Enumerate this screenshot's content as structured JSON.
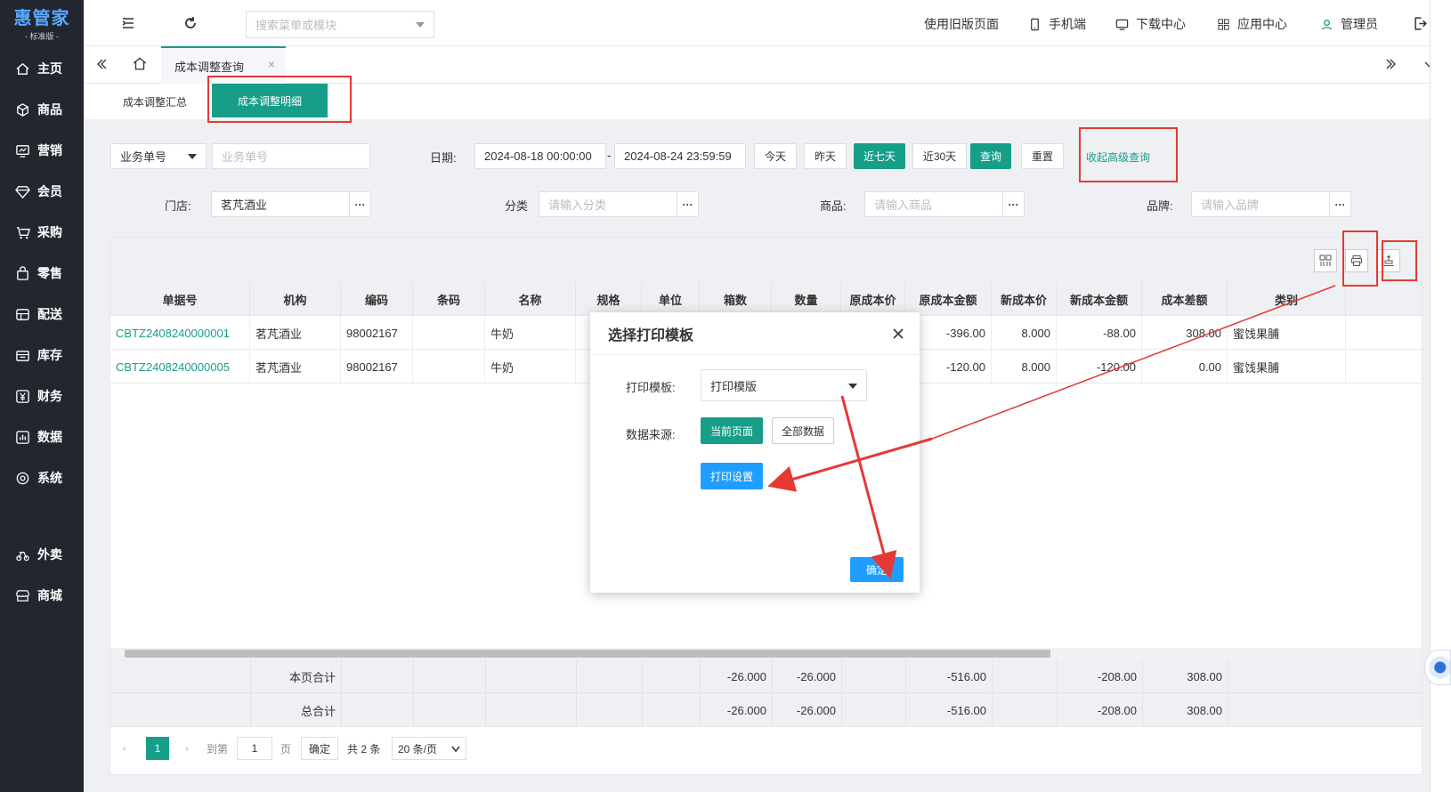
{
  "app": {
    "logo_main": "惠管家",
    "logo_sub": "- 标准版 -"
  },
  "sidebar": {
    "items": [
      {
        "label": "主页",
        "icon": "home-icon"
      },
      {
        "label": "商品",
        "icon": "cube-icon"
      },
      {
        "label": "营销",
        "icon": "chart-icon"
      },
      {
        "label": "会员",
        "icon": "diamond-icon"
      },
      {
        "label": "采购",
        "icon": "cart-icon"
      },
      {
        "label": "零售",
        "icon": "bag-icon"
      },
      {
        "label": "配送",
        "icon": "truck-icon"
      },
      {
        "label": "库存",
        "icon": "warehouse-icon"
      },
      {
        "label": "财务",
        "icon": "yen-icon"
      },
      {
        "label": "数据",
        "icon": "data-icon"
      },
      {
        "label": "系统",
        "icon": "gear-icon"
      },
      {
        "label": "外卖",
        "icon": "delivery-icon"
      },
      {
        "label": "商城",
        "icon": "store-icon"
      }
    ]
  },
  "header": {
    "search_placeholder": "搜索菜单或模块",
    "links": [
      "使用旧版页面",
      "手机端",
      "下载中心",
      "应用中心",
      "管理员"
    ]
  },
  "tabs": {
    "active": "成本调整查询"
  },
  "subtabs": [
    "成本调整汇总",
    "成本调整明细"
  ],
  "filters": {
    "doc_type": "业务单号",
    "doc_placeholder": "业务单号",
    "date_label": "日期:",
    "date_from": "2024-08-18 00:00:00",
    "date_sep": "-",
    "date_to": "2024-08-24 23:59:59",
    "quick": [
      "今天",
      "昨天",
      "近七天",
      "近30天"
    ],
    "query": "查询",
    "reset": "重置",
    "collapse": "收起高级查询",
    "store_label": "门店:",
    "store_value": "茗芃酒业",
    "category_label": "分类",
    "category_placeholder": "请输入分类",
    "product_label": "商品:",
    "product_placeholder": "请输入商品",
    "brand_label": "品牌:",
    "brand_placeholder": "请输入品牌",
    "ellipsis": "···"
  },
  "table": {
    "columns": [
      "单据号",
      "机构",
      "编码",
      "条码",
      "名称",
      "规格",
      "单位",
      "箱数",
      "数量",
      "原成本价",
      "原成本金额",
      "新成本价",
      "新成本金额",
      "成本差额",
      "类别"
    ],
    "rows": [
      [
        "CBTZ2408240000001",
        "茗芃酒业",
        "98002167",
        "",
        "牛奶",
        "",
        "",
        "",
        "",
        "",
        "-396.00",
        "8.000",
        "-88.00",
        "308.00",
        "蜜饯果脯"
      ],
      [
        "CBTZ2408240000005",
        "茗芃酒业",
        "98002167",
        "",
        "牛奶",
        "",
        "",
        "",
        "",
        "",
        "-120.00",
        "8.000",
        "-120.00",
        "0.00",
        "蜜饯果脯"
      ]
    ],
    "summary": [
      {
        "label": "本页合计",
        "boxes": "-26.000",
        "qty": "-26.000",
        "old_amt": "-516.00",
        "new_amt": "-208.00",
        "diff": "308.00"
      },
      {
        "label": "总合计",
        "boxes": "-26.000",
        "qty": "-26.000",
        "old_amt": "-516.00",
        "new_amt": "-208.00",
        "diff": "308.00"
      }
    ]
  },
  "pager": {
    "current": "1",
    "goto": "到第",
    "page_input": "1",
    "page": "页",
    "confirm": "确定",
    "total": "共 2 条",
    "size": "20 条/页"
  },
  "dialog": {
    "title": "选择打印模板",
    "template_label": "打印模板:",
    "template_value": "打印模版",
    "source_label": "数据来源:",
    "source_current": "当前页面",
    "source_all": "全部数据",
    "print_settings": "打印设置",
    "ok": "确定"
  },
  "colors": {
    "accent": "#169e89",
    "sidebar": "#22272f",
    "blue": "#1e9fff",
    "annotation": "#e53935"
  }
}
